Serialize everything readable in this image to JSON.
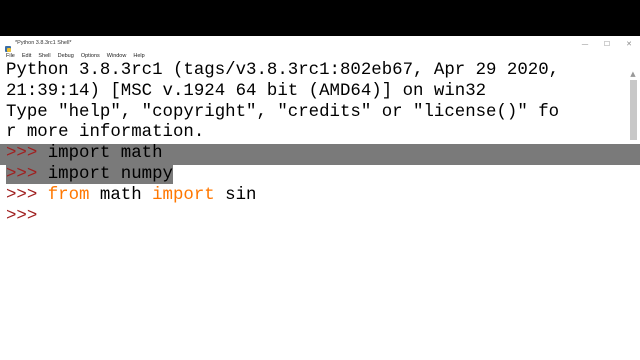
{
  "window": {
    "title": "*Python 3.8.3rc1 Shell*",
    "controls": [
      "—",
      "☐",
      "✕"
    ]
  },
  "menu": [
    "File",
    "Edit",
    "Shell",
    "Debug",
    "Options",
    "Window",
    "Help"
  ],
  "shell": {
    "banner_line1": "Python 3.8.3rc1 (tags/v3.8.3rc1:802eb67, Apr 29 2020,",
    "banner_line2": "21:39:14) [MSC v.1924 64 bit (AMD64)] on win32",
    "banner_line3": "Type \"help\", \"copyright\", \"credits\" or \"license()\" fo",
    "banner_line4": "r more information.",
    "prompt": ">>> ",
    "cmd1": "import math",
    "cmd2_kw": "import",
    "cmd2_mod": " numpy",
    "cmd3_kw1": "from",
    "cmd3_mod": " math ",
    "cmd3_kw2": "import",
    "cmd3_name": " sin"
  },
  "colors": {
    "prompt": "#a02020",
    "keyword": "#ff7700",
    "selection": "#7a7a7a"
  },
  "icons": {
    "app": "python-feather-icon",
    "scroll_up": "scroll-up-arrow-icon"
  }
}
